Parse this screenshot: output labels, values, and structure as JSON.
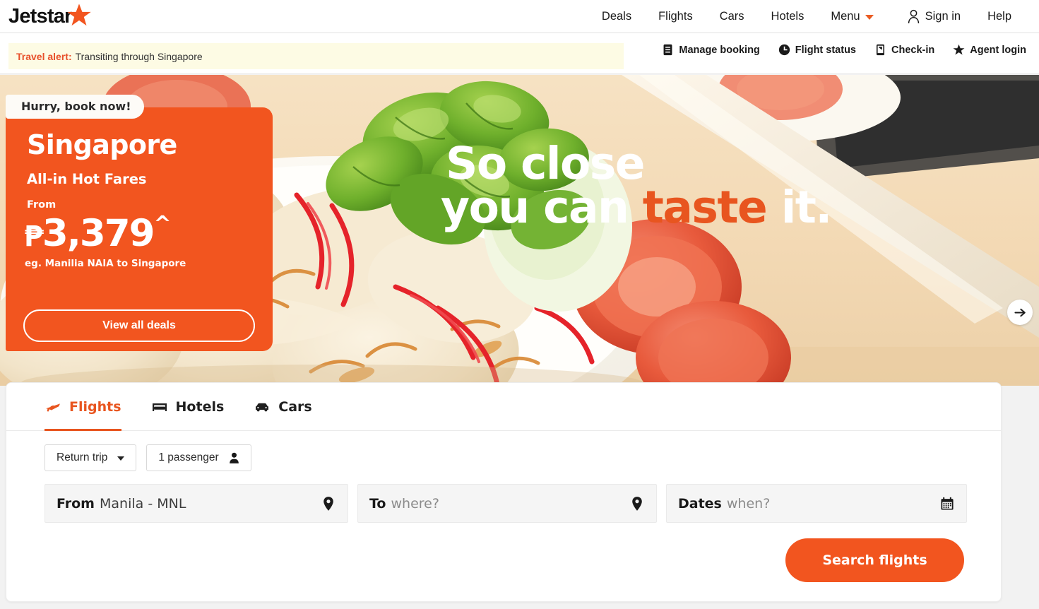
{
  "brand": {
    "name": "Jetstar",
    "star_icon": "star-icon",
    "accent": "#f2551f"
  },
  "topnav": {
    "links": [
      {
        "label": "Deals"
      },
      {
        "label": "Flights"
      },
      {
        "label": "Cars"
      },
      {
        "label": "Hotels"
      },
      {
        "label": "Menu",
        "icon": "chevron-down-icon"
      }
    ],
    "signin": {
      "label": "Sign in",
      "icon": "person-icon"
    },
    "help": {
      "label": "Help"
    }
  },
  "alert": {
    "label": "Travel alert:",
    "text": "Transiting through Singapore",
    "bg": "#fdfbe4",
    "label_color": "#e8502b"
  },
  "quicklinks": [
    {
      "label": "Manage booking",
      "icon": "document-icon"
    },
    {
      "label": "Flight status",
      "icon": "clock-icon"
    },
    {
      "label": "Check-in",
      "icon": "mobile-checkin-icon"
    },
    {
      "label": "Agent login",
      "icon": "star-icon"
    }
  ],
  "hero": {
    "headline_line1": "So close",
    "headline_line2_plain1": "you can ",
    "headline_line2_accent": "taste",
    "headline_line2_plain2": " it.",
    "accent_color": "#e8551f",
    "next_arrow_icon": "arrow-right-icon",
    "dot_indicator": "carousel-dot"
  },
  "promo": {
    "badge": "Hurry, book now!",
    "city": "Singapore",
    "subtitle": "All-in Hot Fares",
    "from_label": "From",
    "currency": "₱",
    "price": "3,379",
    "price_superscript": "^",
    "example": "eg. Manilia NAIA to Singapore",
    "cta": "View all deals",
    "bg": "#f2551f"
  },
  "search": {
    "tabs": [
      {
        "label": "Flights",
        "icon": "plane-icon",
        "active": true
      },
      {
        "label": "Hotels",
        "icon": "bed-icon",
        "active": false
      },
      {
        "label": "Cars",
        "icon": "car-icon",
        "active": false
      }
    ],
    "trip_type": {
      "value": "Return trip",
      "icon": "chevron-down-icon"
    },
    "passengers": {
      "value": "1 passenger",
      "icon": "person-icon"
    },
    "fields": {
      "from": {
        "label": "From",
        "value": "Manila - MNL",
        "icon": "location-pin-icon"
      },
      "to": {
        "label": "To",
        "placeholder": "where?",
        "value": "",
        "icon": "location-pin-icon"
      },
      "dates": {
        "label": "Dates",
        "placeholder": "when?",
        "value": "",
        "icon": "calendar-icon"
      }
    },
    "submit": "Search flights"
  }
}
